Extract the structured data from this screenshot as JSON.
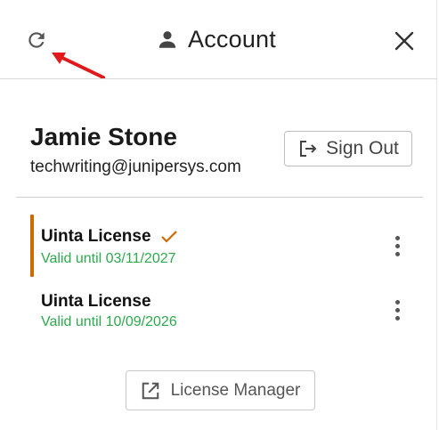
{
  "header": {
    "title": "Account",
    "refresh_icon": "refresh-icon",
    "account_icon": "person-icon",
    "close_icon": "close-icon"
  },
  "user": {
    "name": "Jamie Stone",
    "email": "techwriting@junipersys.com",
    "sign_out_label": "Sign Out"
  },
  "licenses": [
    {
      "name": "Uinta License",
      "valid": "Valid until 03/11/2027",
      "selected": true
    },
    {
      "name": "Uinta License",
      "valid": "Valid until 10/09/2026",
      "selected": false
    }
  ],
  "license_manager_label": "License Manager",
  "colors": {
    "accent": "#cc6a00",
    "valid_text": "#2fa84f",
    "annotation_arrow": "#e0191b"
  }
}
